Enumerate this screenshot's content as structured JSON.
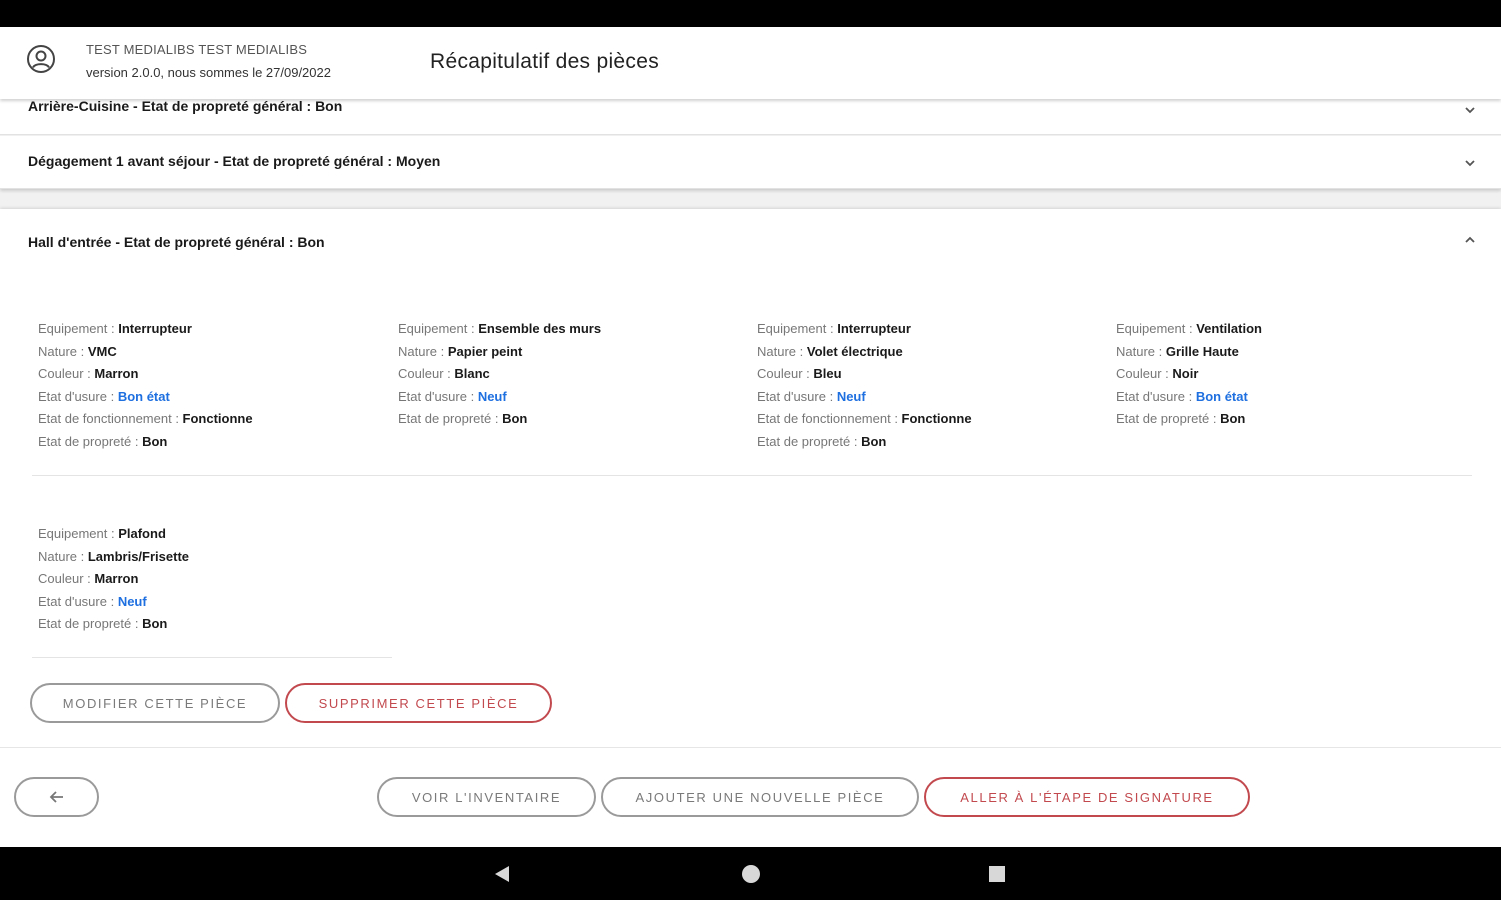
{
  "header": {
    "user_name": "TEST MEDIALIBS TEST MEDIALIBS",
    "version_text": "version 2.0.0, nous sommes le 27/09/2022",
    "title": "Récapitulatif des pièces"
  },
  "rooms": {
    "collapsed": [
      {
        "title": "Arrière-Cuisine - Etat de propreté général : Bon"
      },
      {
        "title": "Dégagement 1 avant séjour - Etat de propreté général : Moyen"
      }
    ],
    "expanded": {
      "title": "Hall d'entrée - Etat de propreté général : Bon",
      "labels": {
        "equipement": "Equipement : ",
        "nature": "Nature : ",
        "couleur": "Couleur : ",
        "usure": "Etat d'usure : ",
        "fonctionnement": "Etat de fonctionnement : ",
        "proprete": "Etat de propreté : "
      },
      "equipments": [
        {
          "equipement": "Interrupteur",
          "nature": "VMC",
          "couleur": "Marron",
          "usure": "Bon état",
          "fonctionnement": "Fonctionne",
          "proprete": "Bon"
        },
        {
          "equipement": "Ensemble des murs",
          "nature": "Papier peint",
          "couleur": "Blanc",
          "usure": "Neuf",
          "proprete": "Bon"
        },
        {
          "equipement": "Interrupteur",
          "nature": "Volet électrique",
          "couleur": "Bleu",
          "usure": "Neuf",
          "fonctionnement": "Fonctionne",
          "proprete": "Bon"
        },
        {
          "equipement": "Ventilation",
          "nature": "Grille Haute",
          "couleur": "Noir",
          "usure": "Bon état",
          "proprete": "Bon"
        },
        {
          "equipement": "Plafond",
          "nature": "Lambris/Frisette",
          "couleur": "Marron",
          "usure": "Neuf",
          "proprete": "Bon"
        }
      ],
      "modify_label": "MODIFIER CETTE PIÈCE",
      "delete_label": "SUPPRIMER CETTE PIÈCE"
    }
  },
  "footer": {
    "inventory_label": "VOIR L'INVENTAIRE",
    "add_room_label": "AJOUTER UNE NOUVELLE PIÈCE",
    "signature_label": "ALLER À L'ÉTAPE DE SIGNATURE"
  },
  "colors": {
    "accent_red": "#c24a4f",
    "link_blue": "#1e6fe0"
  },
  "icons": {
    "avatar": "account-circle-icon",
    "expand": "chevron-down-icon",
    "collapse": "chevron-up-icon",
    "back": "arrow-left-icon"
  }
}
